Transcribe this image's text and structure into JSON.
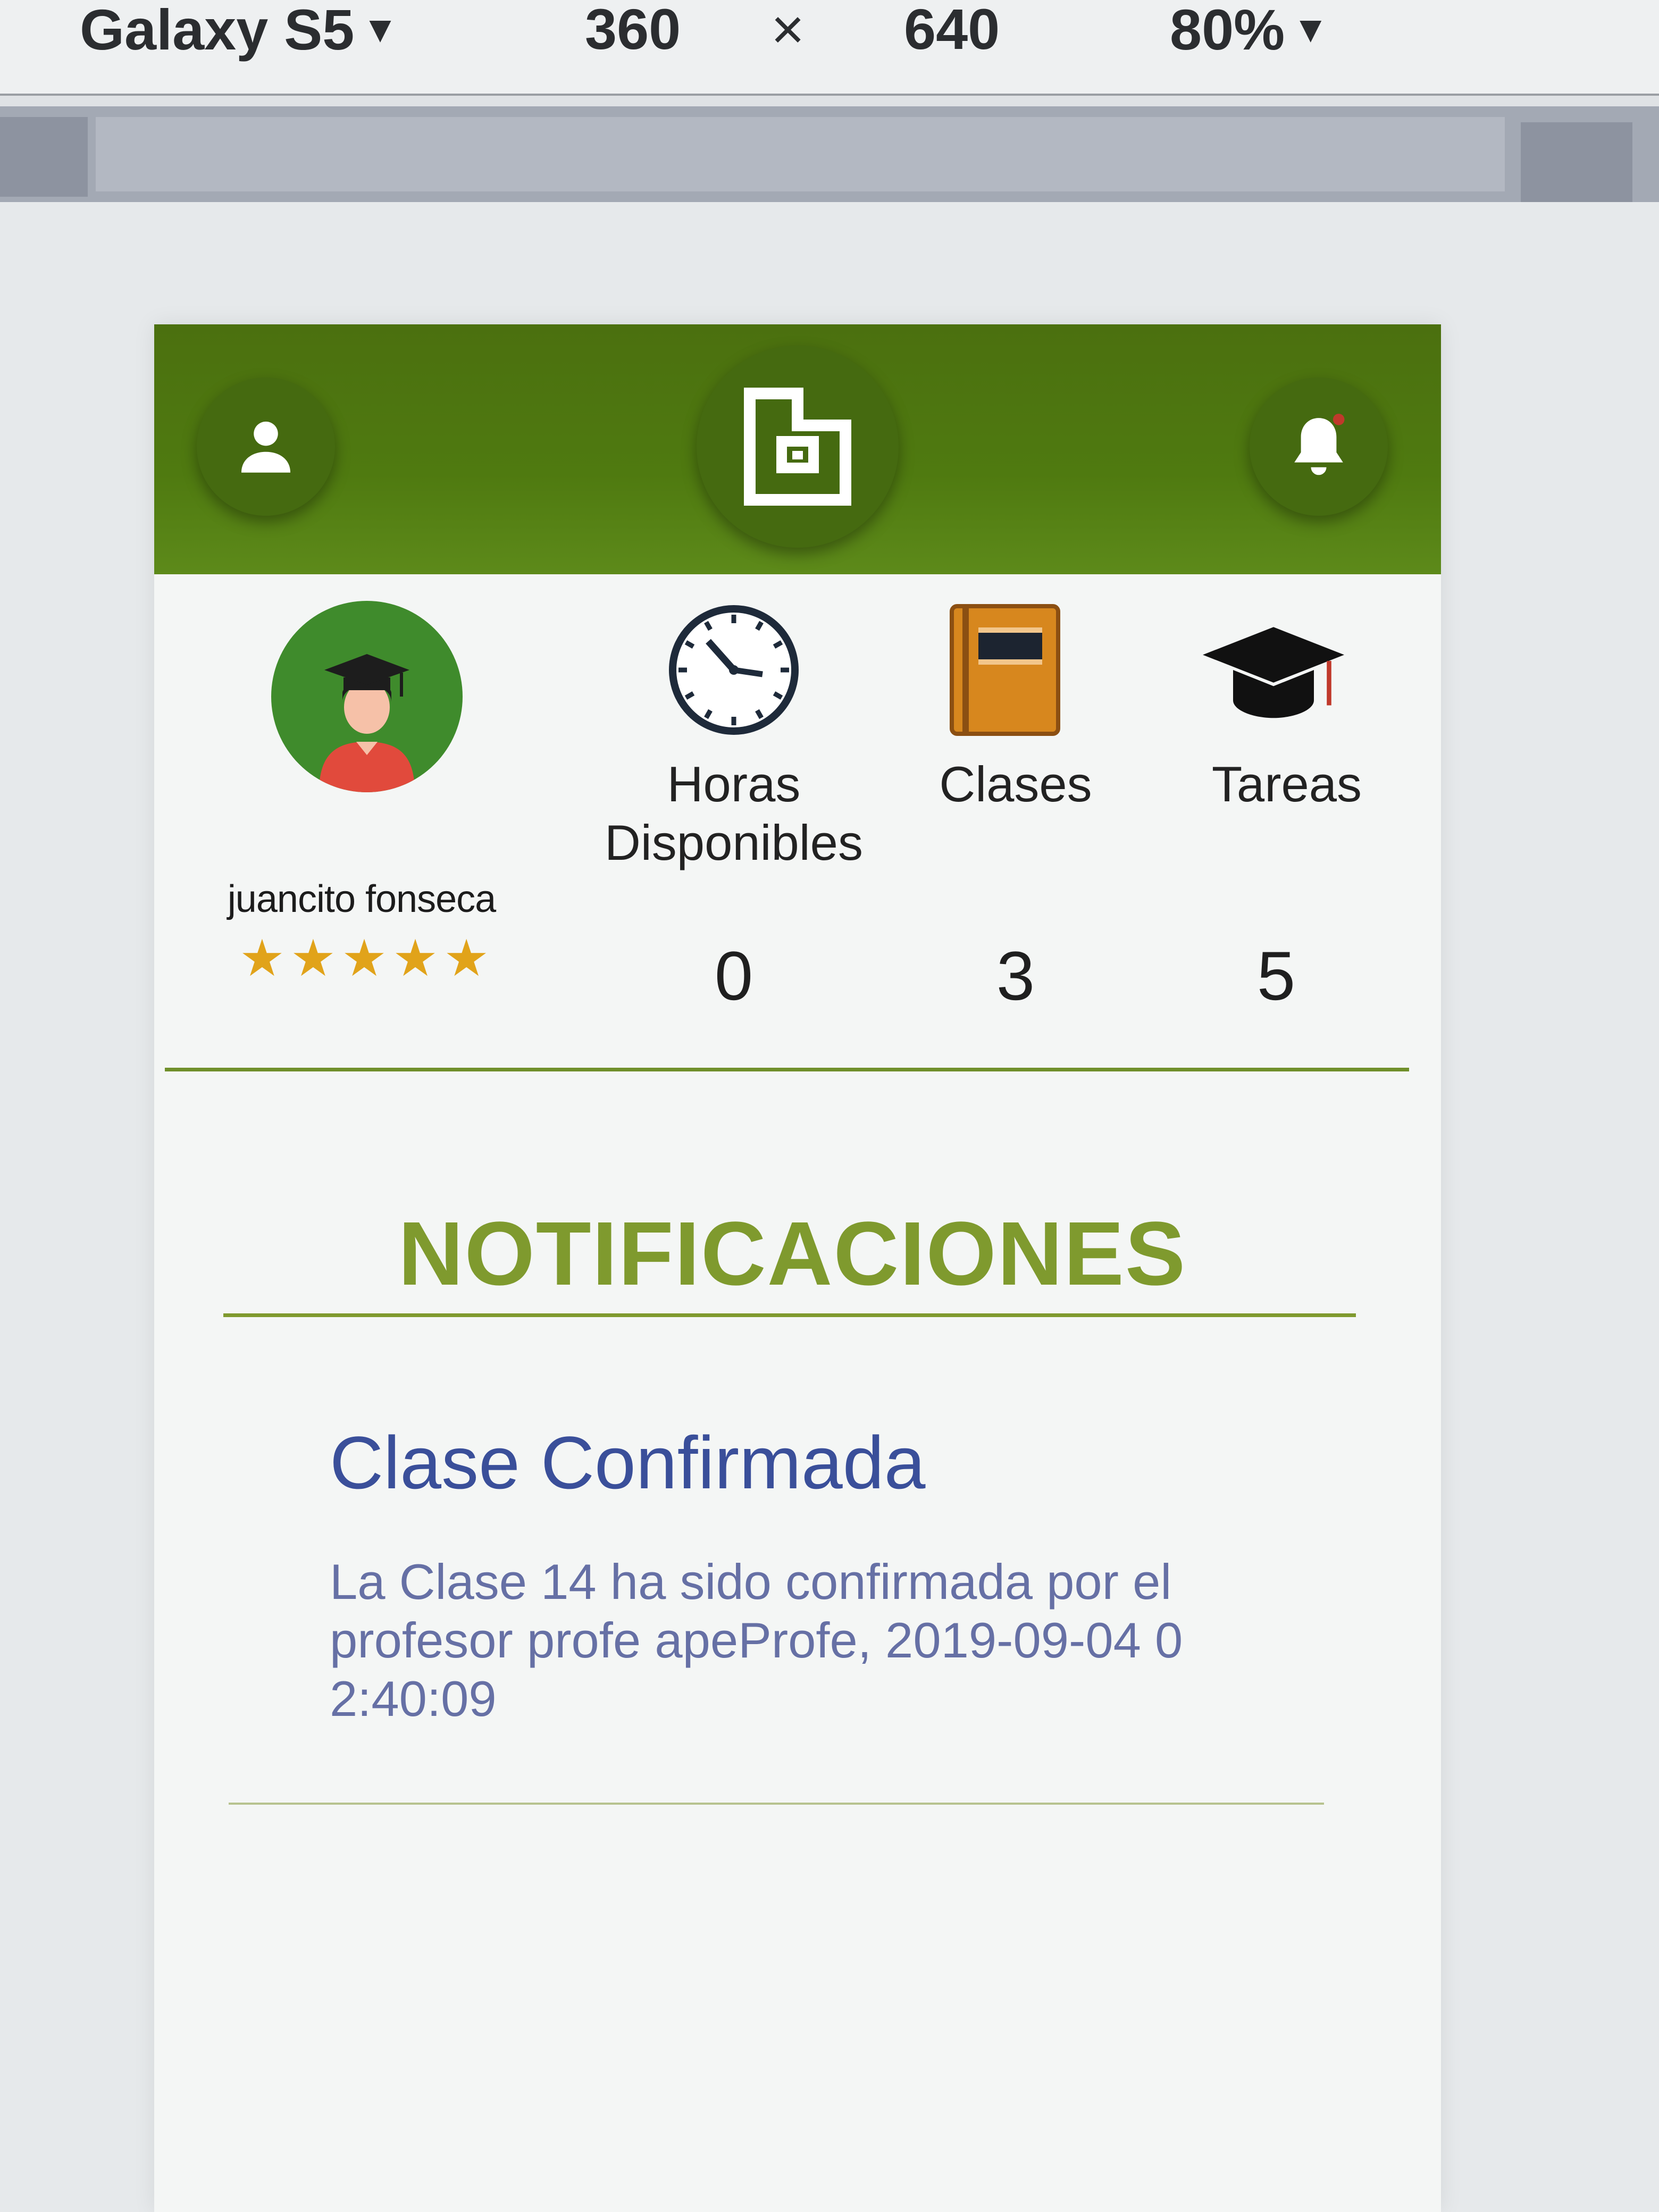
{
  "devtools": {
    "device": "Galaxy S5",
    "width": "360",
    "times": "×",
    "height": "640",
    "zoom": "80%",
    "caret": "▼"
  },
  "header": {
    "user_icon": "user-icon",
    "logo_icon": "app-logo-icon",
    "bell_icon": "bell-icon"
  },
  "profile": {
    "name": "juancito fonseca",
    "rating": 5,
    "star_glyph": "★"
  },
  "stats": {
    "horas": {
      "label": "Horas Disponibles",
      "value": "0",
      "icon": "clock-icon"
    },
    "clases": {
      "label": "Clases",
      "value": "3",
      "icon": "book-icon"
    },
    "tareas": {
      "label": "Tareas",
      "value": "5",
      "icon": "graduation-cap-icon"
    }
  },
  "notifications": {
    "heading": "NOTIFICACIONES",
    "items": [
      {
        "title": "Clase Confirmada",
        "body": "La Clase 14 ha sido confirmada por el profesor profe apeProfe, 2019-09-04 02:40:09"
      }
    ]
  },
  "colors": {
    "header_green": "#4f7a10",
    "accent_green": "#7f9a2e",
    "notif_title": "#3a4f9a",
    "star": "#e1a31a"
  }
}
